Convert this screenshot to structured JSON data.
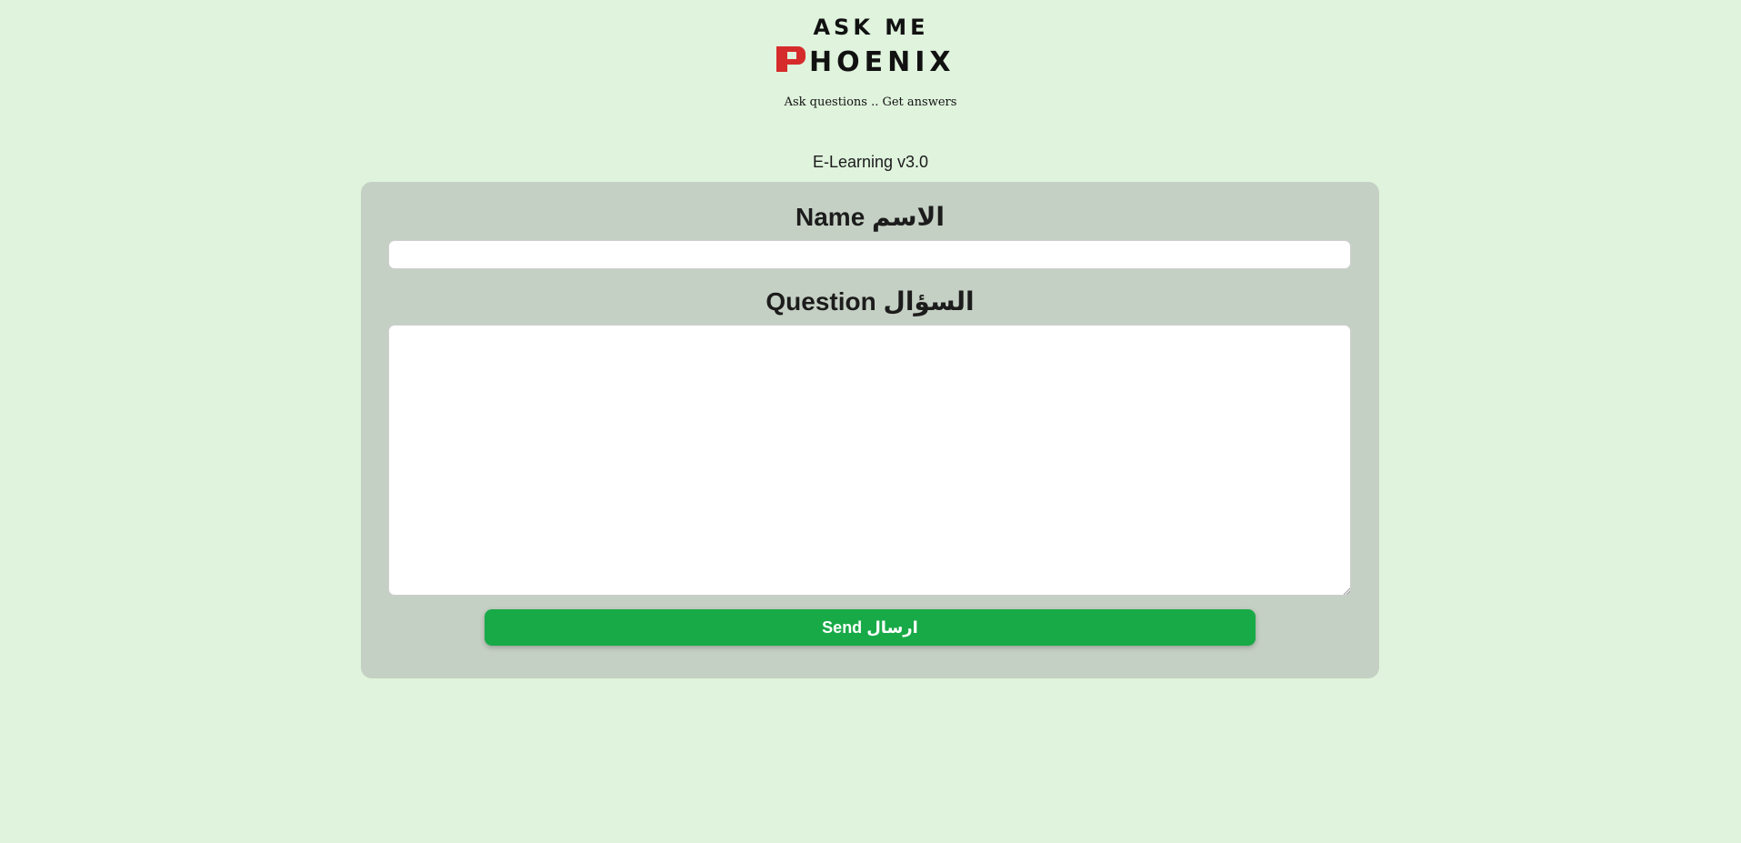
{
  "header": {
    "logo": {
      "line1": "ASK ME",
      "line2": "PHOENIX",
      "accent_color": "#d62b2b",
      "text_color": "#111111"
    },
    "tagline": "Ask questions .. Get answers",
    "version": "E-Learning v3.0"
  },
  "form": {
    "name_label": "Name الاسم",
    "name_value": "",
    "question_label": "Question السؤال",
    "question_value": "",
    "send_label": "Send ارسال"
  },
  "colors": {
    "background": "#dff3dd",
    "card": "#c5d0c4",
    "button": "#18aa47"
  }
}
